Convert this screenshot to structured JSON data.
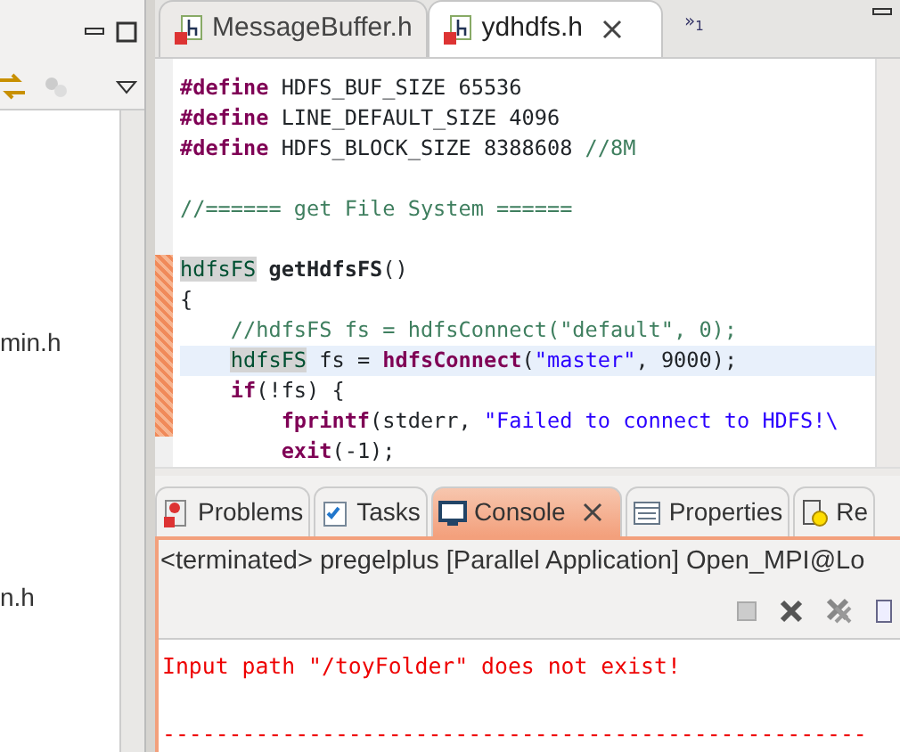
{
  "left_panel": {
    "items": [
      {
        "label": "min.h"
      },
      {
        "label": "n.h"
      }
    ]
  },
  "editor": {
    "tabs": [
      {
        "label": "MessageBuffer.h",
        "selected": false
      },
      {
        "label": "ydhdfs.h",
        "selected": true
      }
    ],
    "overflow": "»",
    "overflow_count": "1",
    "lines": [
      {
        "kind": "top",
        "segments": [
          {
            "kind": "directive",
            "text": "#define"
          },
          {
            "kind": "plain",
            "text": " HDFS_BUF_SIZE 65536"
          }
        ]
      },
      {
        "kind": "top",
        "segments": [
          {
            "kind": "directive",
            "text": "#define"
          },
          {
            "kind": "plain",
            "text": " LINE_DEFAULT_SIZE 4096"
          }
        ]
      },
      {
        "kind": "top",
        "segments": [
          {
            "kind": "directive",
            "text": "#define"
          },
          {
            "kind": "plain",
            "text": " HDFS_BLOCK_SIZE 8388608 "
          },
          {
            "kind": "comment",
            "text": "//8M"
          }
        ]
      },
      {
        "kind": "top",
        "gap_before": true,
        "segments": [
          {
            "kind": "comment",
            "text": "//====== get File System ======"
          }
        ]
      },
      {
        "kind": "top",
        "gap_before": true,
        "changed": true,
        "segments": [
          {
            "kind": "occurrence",
            "text": "hdfsFS"
          },
          {
            "kind": "bold",
            "text": " getHdfsFS"
          },
          {
            "kind": "plain",
            "text": "()"
          }
        ]
      },
      {
        "kind": "top",
        "changed": true,
        "segments": [
          {
            "kind": "plain",
            "text": "{"
          }
        ]
      },
      {
        "kind": "inner",
        "changed": true,
        "segments": [
          {
            "kind": "comment",
            "text": "//hdfsFS fs = hdfsConnect(\"default\", 0);"
          }
        ]
      },
      {
        "kind": "inner",
        "changed": true,
        "current": true,
        "segments": [
          {
            "kind": "occurrence",
            "text": "hdfsFS"
          },
          {
            "kind": "plain",
            "text": " fs = "
          },
          {
            "kind": "call",
            "text": "hdfsConnect"
          },
          {
            "kind": "plain",
            "text": "("
          },
          {
            "kind": "string",
            "text": "\"master\""
          },
          {
            "kind": "plain",
            "text": ", 9000);"
          }
        ]
      },
      {
        "kind": "inner",
        "changed": true,
        "segments": [
          {
            "kind": "call",
            "text": "if"
          },
          {
            "kind": "plain",
            "text": "(!fs) {"
          }
        ]
      },
      {
        "kind": "nested",
        "changed": true,
        "segments": [
          {
            "kind": "call",
            "text": "fprintf"
          },
          {
            "kind": "plain",
            "text": "(stderr, "
          },
          {
            "kind": "string",
            "text": "\"Failed to connect to HDFS!\\"
          }
        ]
      },
      {
        "kind": "nested",
        "segments": [
          {
            "kind": "call",
            "text": "exit"
          },
          {
            "kind": "plain",
            "text": "(-1);"
          }
        ]
      }
    ]
  },
  "bottom": {
    "tabs": [
      {
        "label": "Problems",
        "selected": false
      },
      {
        "label": "Tasks",
        "selected": false
      },
      {
        "label": "Console",
        "selected": true
      },
      {
        "label": "Properties",
        "selected": false
      },
      {
        "label": "Re",
        "selected": false
      }
    ],
    "header": "<terminated> pregelplus [Parallel Application] Open_MPI@Lo",
    "output": [
      {
        "text": "Input path \"/toyFolder\" does not exist!"
      },
      {
        "text": "-----------------------------------------------------",
        "gap_before": true
      }
    ]
  }
}
